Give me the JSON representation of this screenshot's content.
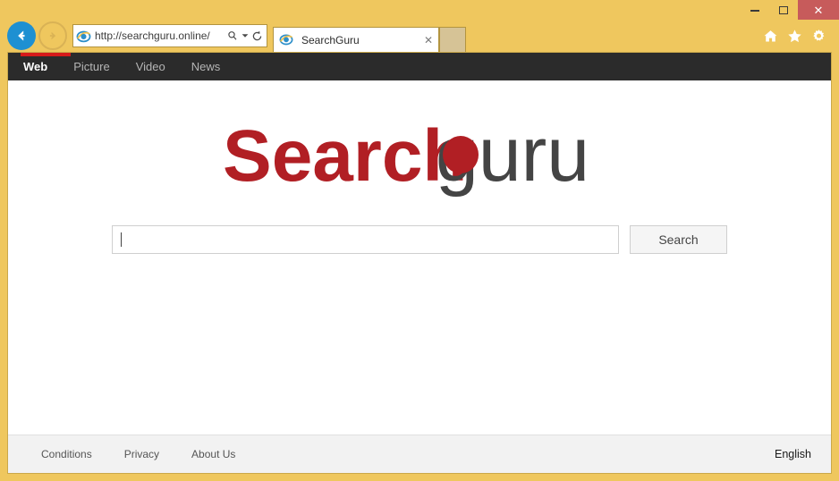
{
  "browser": {
    "window_controls": {
      "minimize_label": "—",
      "maximize_label": "□",
      "close_label": "✕"
    },
    "back_icon": "back-arrow-icon",
    "forward_icon": "forward-arrow-icon",
    "address": {
      "url": "http://searchguru.online/",
      "favicon": "internet-explorer-icon",
      "search_icon": "magnifier-icon",
      "dropdown_icon": "chevron-down-icon",
      "refresh_icon": "refresh-icon"
    },
    "tab": {
      "title": "SearchGuru",
      "favicon": "internet-explorer-icon",
      "close_label": "✕"
    },
    "new_tab_label": "",
    "toolbar_icons": [
      {
        "name": "home-icon",
        "glyph": "⌂"
      },
      {
        "name": "favorites-star-icon",
        "glyph": "★"
      },
      {
        "name": "settings-gear-icon",
        "glyph": "⚙"
      }
    ]
  },
  "page": {
    "nav": {
      "items": [
        {
          "label": "Web",
          "active": true
        },
        {
          "label": "Picture",
          "active": false
        },
        {
          "label": "Video",
          "active": false
        },
        {
          "label": "News",
          "active": false
        }
      ],
      "accent_color": "#d61a1a",
      "background_color": "#2b2b2b"
    },
    "logo": {
      "part1": "Search",
      "part2": "guru",
      "part1_color": "#b11f24",
      "part2_color": "#444444",
      "dot_color": "#b11f24"
    },
    "search": {
      "value": "",
      "placeholder": "",
      "button_label": "Search"
    },
    "footer": {
      "links": [
        {
          "label": "Conditions"
        },
        {
          "label": "Privacy"
        },
        {
          "label": "About Us"
        }
      ],
      "language": "English"
    }
  }
}
